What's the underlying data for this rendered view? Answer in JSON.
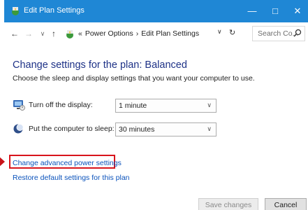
{
  "window": {
    "title": "Edit Plan Settings",
    "controls": {
      "minimize": "—",
      "maximize": "□",
      "close": "✕"
    }
  },
  "addressbar": {
    "back": "←",
    "forward": "→",
    "recent": "∨",
    "up": "↑",
    "overflow": "«",
    "breadcrumb": [
      "Power Options",
      "Edit Plan Settings"
    ],
    "separator": "›",
    "dropdown": "∨",
    "refresh": "↻",
    "search_placeholder": "Search Co..."
  },
  "main": {
    "heading": "Change settings for the plan: Balanced",
    "subtext": "Choose the sleep and display settings that you want your computer to use.",
    "display_label": "Turn off the display:",
    "display_value": "1 minute",
    "sleep_label": "Put the computer to sleep:",
    "sleep_value": "30 minutes",
    "advanced_link": "Change advanced power settings",
    "restore_link": "Restore default settings for this plan",
    "save_label": "Save changes",
    "cancel_label": "Cancel"
  },
  "icons": {
    "app": "power-options-icon",
    "display": "monitor-icon",
    "sleep": "moon-sleep-icon",
    "search": "magnifier-icon"
  },
  "colors": {
    "titlebar": "#1f87d5",
    "heading": "#1e3287",
    "link": "#0a52bb",
    "highlight": "#d8141c"
  }
}
